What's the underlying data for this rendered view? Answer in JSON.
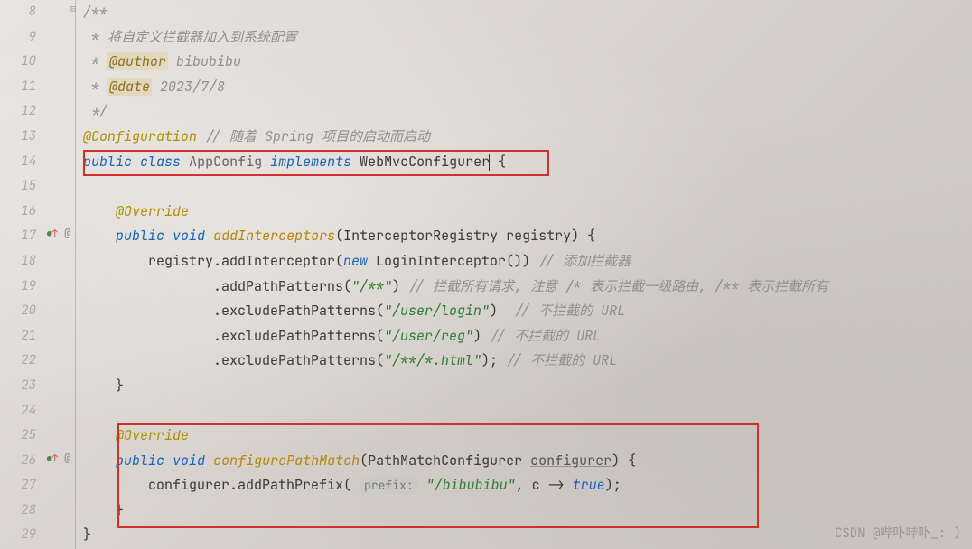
{
  "line_numbers": [
    "8",
    "9",
    "10",
    "11",
    "12",
    "13",
    "14",
    "15",
    "16",
    "17",
    "18",
    "19",
    "20",
    "21",
    "22",
    "23",
    "24",
    "25",
    "26",
    "27",
    "28",
    "29"
  ],
  "code": {
    "l8": "/**",
    "l9_prefix": " * ",
    "l9_text": "将自定义拦截器加入到系统配置",
    "l10_prefix": " * ",
    "l10_tag": "@author",
    "l10_val": " bibubibu",
    "l11_prefix": " * ",
    "l11_tag": "@date",
    "l11_val": " 2023/7/8",
    "l12": " */",
    "l13_anno": "@Configuration",
    "l13_comment": "// 随着 Spring 项目的启动而启动",
    "l14_public": "public",
    "l14_class": "class",
    "l14_name": "AppConfig",
    "l14_implements": "implements",
    "l14_iface": "WebMvcConfigurer",
    "l14_brace": " {",
    "l16_override": "@Override",
    "l17_public": "public",
    "l17_void": "void",
    "l17_method": "addInterceptors",
    "l17_params": "(InterceptorRegistry registry) {",
    "l18_a": "registry.addInterceptor(",
    "l18_new": "new",
    "l18_b": " LoginInterceptor()) ",
    "l18_c": "// 添加拦截器",
    "l19_a": ".addPathPatterns(",
    "l19_s": "\"/**\"",
    "l19_b": ") ",
    "l19_c": "// 拦截所有请求, 注意 /* 表示拦截一级路由, /** 表示拦截所有",
    "l20_a": ".excludePathPatterns(",
    "l20_s": "\"/user/login\"",
    "l20_b": ")  ",
    "l20_c": "// 不拦截的 URL",
    "l21_a": ".excludePathPatterns(",
    "l21_s": "\"/user/reg\"",
    "l21_b": ") ",
    "l21_c": "// 不拦截的 URL",
    "l22_a": ".excludePathPatterns(",
    "l22_s": "\"/**/*.html\"",
    "l22_b": "); ",
    "l22_c": "// 不拦截的 URL",
    "l23_brace": "}",
    "l25_override": "@Override",
    "l26_public": "public",
    "l26_void": "void",
    "l26_method": "configurePathMatch",
    "l26_p1": "(PathMatchConfigurer ",
    "l26_p2": "configurer",
    "l26_p3": ") {",
    "l27_a": "configurer.addPathPrefix( ",
    "l27_hint": "prefix:",
    "l27_s": " \"/bibubibu\"",
    "l27_b": ", c -> ",
    "l27_true": "true",
    "l27_c": ");",
    "l28_brace": "}",
    "l29_brace": "}"
  },
  "watermark": "CSDN @哔卟哔卟_: )"
}
